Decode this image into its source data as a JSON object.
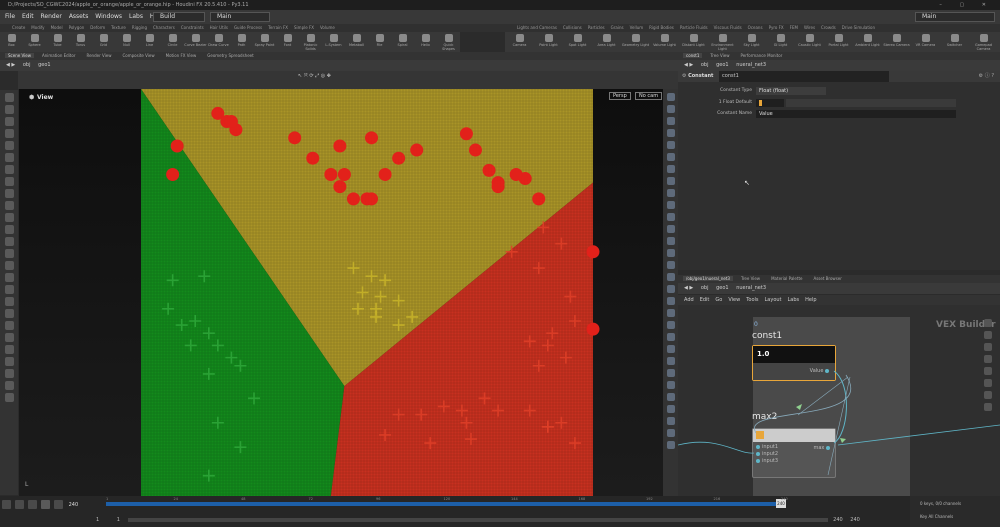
{
  "window": {
    "title": "D:/Projects/SO_CGWC2024/apple_or_orange/apple_or_orange.hip - Houdini FX 20.5.410 - Py3.11"
  },
  "menu": {
    "items": [
      "File",
      "Edit",
      "Render",
      "Assets",
      "Windows",
      "Labs",
      "Help"
    ],
    "desktop_left": "Build",
    "desktop_right": "Main"
  },
  "shelf": {
    "tabs_left": [
      "Create",
      "Modify",
      "Model",
      "Polygon",
      "Deform",
      "Texture",
      "Rigging",
      "Characters",
      "Constraints",
      "Hair Utils",
      "Guide Process",
      "Terrain FX",
      "Simple FX",
      "Volume"
    ],
    "tabs_right": [
      "Lights and Cameras",
      "Collisions",
      "Particles",
      "Grains",
      "Vellum",
      "Rigid Bodies",
      "Particle Fluids",
      "Viscous Fluids",
      "Oceans",
      "Pyro FX",
      "FEM",
      "Wires",
      "Crowds",
      "Drive Simulation"
    ],
    "tools_left": [
      "Box",
      "Sphere",
      "Tube",
      "Torus",
      "Grid",
      "Null",
      "Line",
      "Circle",
      "Curve Bezier",
      "Draw Curve",
      "Path",
      "Spray Paint",
      "Font",
      "Platonic Solids",
      "L-System",
      "Metaball",
      "File",
      "Spiral",
      "Helix",
      "Quick Shapes"
    ],
    "tools_right": [
      "Camera",
      "Point Light",
      "Spot Light",
      "Area Light",
      "Geometry Light",
      "Volume Light",
      "Distant Light",
      "Environment Light",
      "Sky Light",
      "GI Light",
      "Caustic Light",
      "Portal Light",
      "Ambient Light",
      "Stereo Camera",
      "VR Camera",
      "Switcher",
      "Gamepad Camera"
    ]
  },
  "viewer": {
    "tabs": [
      "Scene View",
      "Animation Editor",
      "Render View",
      "Composite View",
      "Motion FX View",
      "Geometry Spreadsheet"
    ],
    "path": [
      "obj",
      "geo1"
    ],
    "label": "View",
    "persp": "Persp",
    "cam": "No cam",
    "corner": "L"
  },
  "timeline": {
    "current_frame": "240",
    "start": "1",
    "start2": "1",
    "end": "240",
    "end2": "240",
    "ticks": [
      "1",
      "24",
      "48",
      "72",
      "96",
      "120",
      "144",
      "168",
      "192",
      "216",
      "240"
    ],
    "keys_label": "0 keys, 0/0 channels",
    "key_all": "Key All Channels"
  },
  "params": {
    "tabs": [
      "const1",
      "Tree View",
      "Performance Monitor"
    ],
    "path": [
      "obj",
      "geo1",
      "nueral_net3"
    ],
    "node_type": "Constant",
    "node_name": "const1",
    "rows": [
      {
        "label": "Constant Type",
        "value": "Float (float)"
      },
      {
        "label": "1 Float Default",
        "value": "1"
      },
      {
        "label": "Constant Name",
        "value": "Value"
      }
    ]
  },
  "network": {
    "tabs": [
      "/obj/geo1/nueral_net3",
      "Tree View",
      "Material Palette",
      "Asset Browser"
    ],
    "path": [
      "obj",
      "geo1",
      "nueral_net3"
    ],
    "menu": [
      "Add",
      "Edit",
      "Go",
      "View",
      "Tools",
      "Layout",
      "Labs",
      "Help"
    ],
    "context_label": "VEX Builder",
    "index_label": "0",
    "const_node": {
      "name": "const1",
      "value": "1.0",
      "output": "Value"
    },
    "max_node": {
      "name": "max2",
      "inputs": [
        "input1",
        "input2",
        "input3"
      ],
      "output": "max"
    }
  },
  "colors": {
    "green": "#138a1c",
    "yellow": "#a99427",
    "red": "#c8301f",
    "apple": "#e2211a",
    "accent": "#e8a63a"
  },
  "chart_data": {
    "type": "scatter",
    "regions": [
      "green",
      "yellow",
      "red"
    ],
    "series": [
      {
        "marker": "circle",
        "color": "#e2211a",
        "x": [
          17,
          19,
          21,
          20,
          34,
          44,
          51,
          57,
          38,
          42,
          45,
          54,
          61,
          72,
          74,
          77,
          79,
          85,
          83,
          8,
          7,
          44,
          47,
          50,
          51,
          79,
          88,
          100,
          100
        ],
        "y": [
          94,
          92,
          90,
          92,
          88,
          86,
          88,
          83,
          83,
          79,
          79,
          79,
          85,
          89,
          85,
          80,
          77,
          78,
          79,
          86,
          79,
          76,
          73,
          73,
          73,
          76,
          73,
          60,
          41
        ]
      },
      {
        "marker": "plus",
        "color": "#c9b52a",
        "x": [
          47,
          51,
          54,
          49,
          53,
          52,
          57,
          48,
          60,
          52,
          57
        ],
        "y": [
          56,
          54,
          53,
          50,
          49,
          46,
          48,
          46,
          44,
          44,
          42
        ]
      },
      {
        "marker": "plus",
        "color": "#2fa83a",
        "x": [
          7,
          14,
          6,
          9,
          12,
          15,
          17,
          20,
          11,
          22,
          15,
          25,
          17,
          22,
          15
        ],
        "y": [
          53,
          54,
          46,
          42,
          43,
          40,
          37,
          34,
          37,
          32,
          30,
          24,
          18,
          12,
          5
        ]
      },
      {
        "marker": "plus",
        "color": "#e04028",
        "x": [
          89,
          82,
          93,
          88,
          95,
          96,
          91,
          86,
          90,
          94,
          88,
          57,
          62,
          71,
          67,
          76,
          79,
          72,
          86,
          90,
          93,
          73,
          54,
          64,
          90,
          96
        ],
        "y": [
          66,
          60,
          62,
          56,
          49,
          43,
          40,
          38,
          37,
          34,
          32,
          20,
          20,
          21,
          22,
          24,
          21,
          18,
          21,
          17,
          18,
          14,
          15,
          13,
          17,
          13
        ]
      }
    ]
  }
}
